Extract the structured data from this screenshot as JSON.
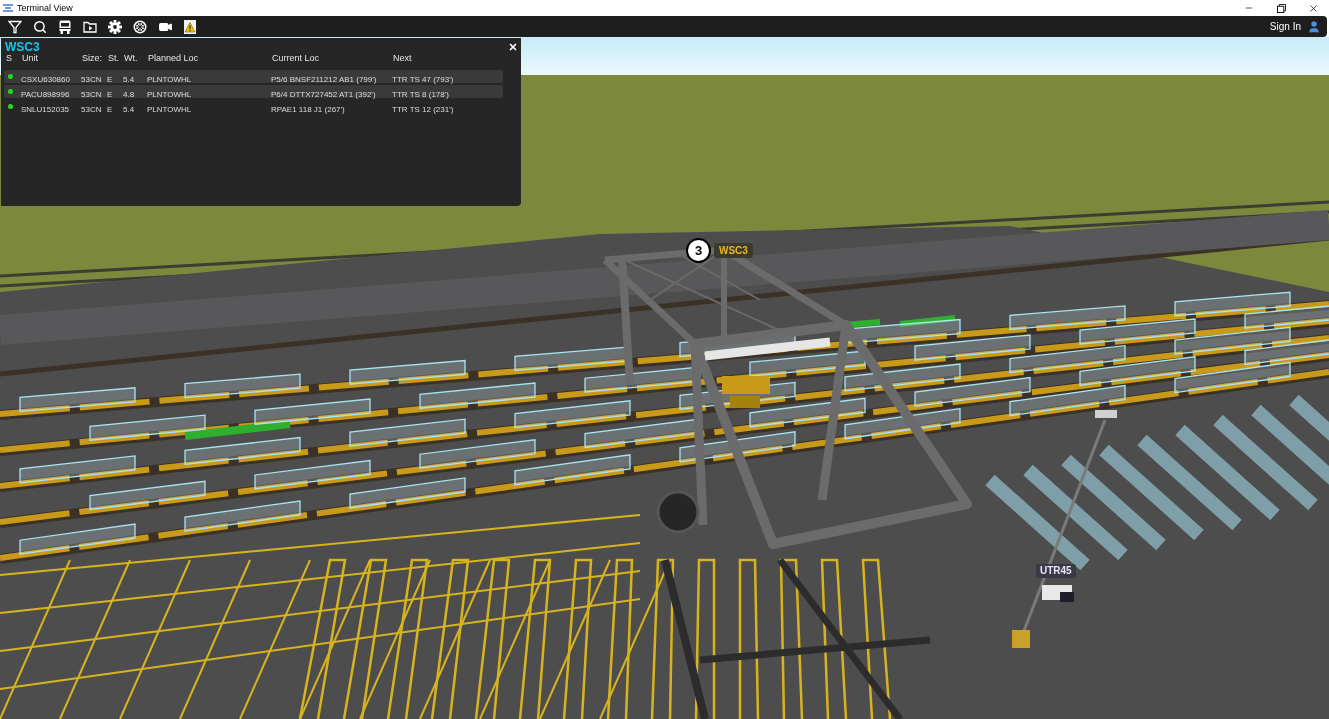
{
  "window": {
    "title": "Terminal View"
  },
  "toolbar": {
    "sign_in": "Sign In"
  },
  "panel": {
    "title": "WSC3",
    "columns": [
      "S",
      "Unit",
      "Size:",
      "St.",
      "Wt.",
      "Planned Loc",
      "Current Loc",
      "Next"
    ],
    "rows": [
      {
        "color": "#22dd22",
        "selected": true,
        "cells": [
          "",
          "CSXU630860",
          "53CN",
          "E",
          "5.4",
          "PLNTOWHL",
          "P5/6 BNSF211212 AB1 (799')",
          "TTR TS 47 (793')"
        ]
      },
      {
        "color": "#22dd22",
        "selected": true,
        "cells": [
          "",
          "PACU898996",
          "53CN",
          "E",
          "4.8",
          "PLNTOWHL",
          "P6/4 DTTX727452 AT1 (392')",
          "TTR TS 8 (178')"
        ]
      },
      {
        "color": "#22dd22",
        "selected": false,
        "cells": [
          "",
          "SNLU152035",
          "53CN",
          "E",
          "5.4",
          "PLNTOWHL",
          "RPAE1 118 J1 (267')",
          "TTR TS 12 (231')"
        ]
      }
    ]
  },
  "scene": {
    "labels": [
      {
        "kind": "numbered",
        "number": "3",
        "text": "WSC3"
      },
      {
        "kind": "plain",
        "text": "UTR45"
      }
    ]
  }
}
